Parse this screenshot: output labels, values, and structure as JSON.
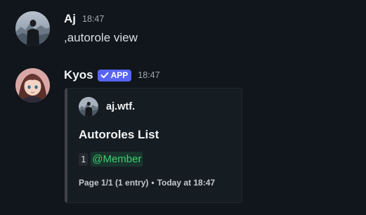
{
  "messages": [
    {
      "username": "Aj",
      "timestamp": "18:47",
      "content": ",autorole view",
      "avatar_icon": "user-avatar-icon"
    },
    {
      "username": "Kyos",
      "app_badge": "APP",
      "timestamp": "18:47",
      "avatar_icon": "bot-avatar-icon",
      "embed": {
        "author_name": "aj.wtf.",
        "author_icon": "user-avatar-icon",
        "title": "Autoroles List",
        "entries": [
          {
            "index": "1",
            "role": "@Member"
          }
        ],
        "footer_text": "Page 1/1 (1 entry)",
        "footer_separator": "•",
        "footer_time": "Today at 18:47"
      }
    }
  ],
  "colors": {
    "background": "#10161b",
    "app_badge": "#5865f2",
    "role_mention": "#3ecf6f",
    "embed_background": "#161d22",
    "embed_border_left": "#3e4148"
  }
}
